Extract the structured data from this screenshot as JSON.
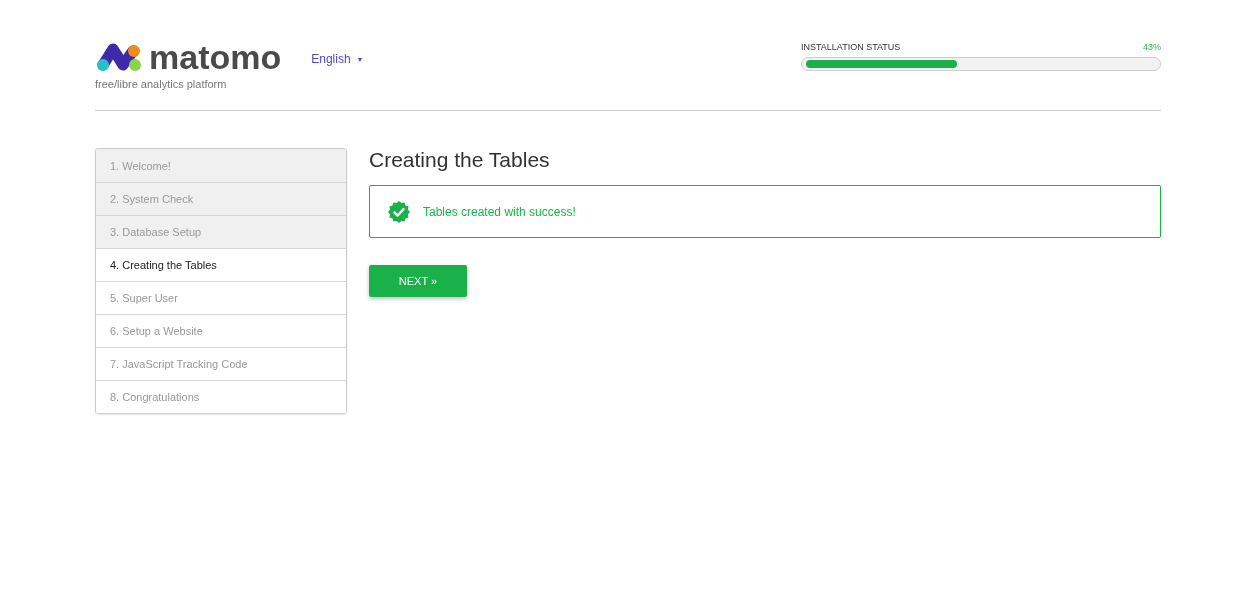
{
  "header": {
    "logo_text": "matomo",
    "tagline": "free/libre analytics platform",
    "language": "English",
    "language_caret": "▼"
  },
  "installation_status": {
    "label": "INSTALLATION STATUS",
    "percent": "43%",
    "level": 0.43
  },
  "steps": [
    {
      "label": "1. Welcome!",
      "done": true,
      "selected": false
    },
    {
      "label": "2. System Check",
      "done": true,
      "selected": false
    },
    {
      "label": "3. Database Setup",
      "done": true,
      "selected": false
    },
    {
      "label": "4. Creating the Tables",
      "done": false,
      "selected": true
    },
    {
      "label": "5. Super User",
      "done": false,
      "selected": false
    },
    {
      "label": "6. Setup a Website",
      "done": false,
      "selected": false
    },
    {
      "label": "7. JavaScript Tracking Code",
      "done": false,
      "selected": false
    },
    {
      "label": "8. Congratulations",
      "done": false,
      "selected": false
    }
  ],
  "content": {
    "title": "Creating the Tables",
    "message": "Tables created with success!",
    "next_button": "NEXT »"
  }
}
